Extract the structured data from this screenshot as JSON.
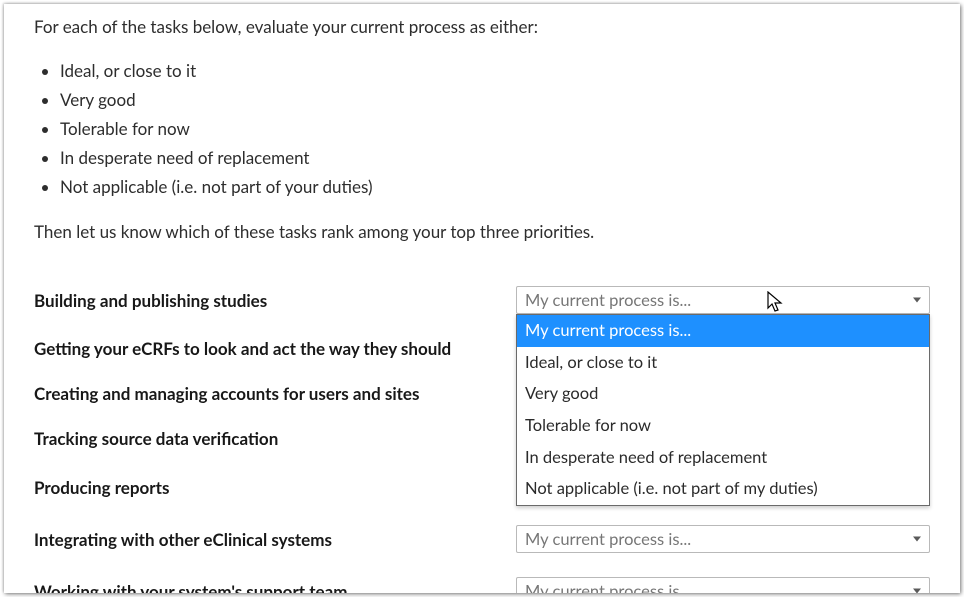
{
  "intro": "For each of the tasks below, evaluate your current process as either:",
  "optionBullets": [
    "Ideal, or close to it",
    "Very good",
    "Tolerable for now",
    "In desperate need of replacement",
    "Not applicable (i.e. not part of your duties)"
  ],
  "followup": "Then let us know which of these tasks rank among your top three priorities.",
  "placeholder": "My current process is...",
  "tasks": [
    "Building and publishing studies",
    "Getting your eCRFs to look and act the way they should",
    "Creating and managing accounts for users and sites",
    "Tracking source data verification",
    "Producing reports",
    "Integrating with other eClinical systems",
    "Working with your system's support team"
  ],
  "dropdownOptions": [
    "My current process is...",
    "Ideal, or close to it",
    "Very good",
    "Tolerable for now",
    "In desperate need of replacement",
    "Not applicable (i.e. not part of my duties)"
  ]
}
